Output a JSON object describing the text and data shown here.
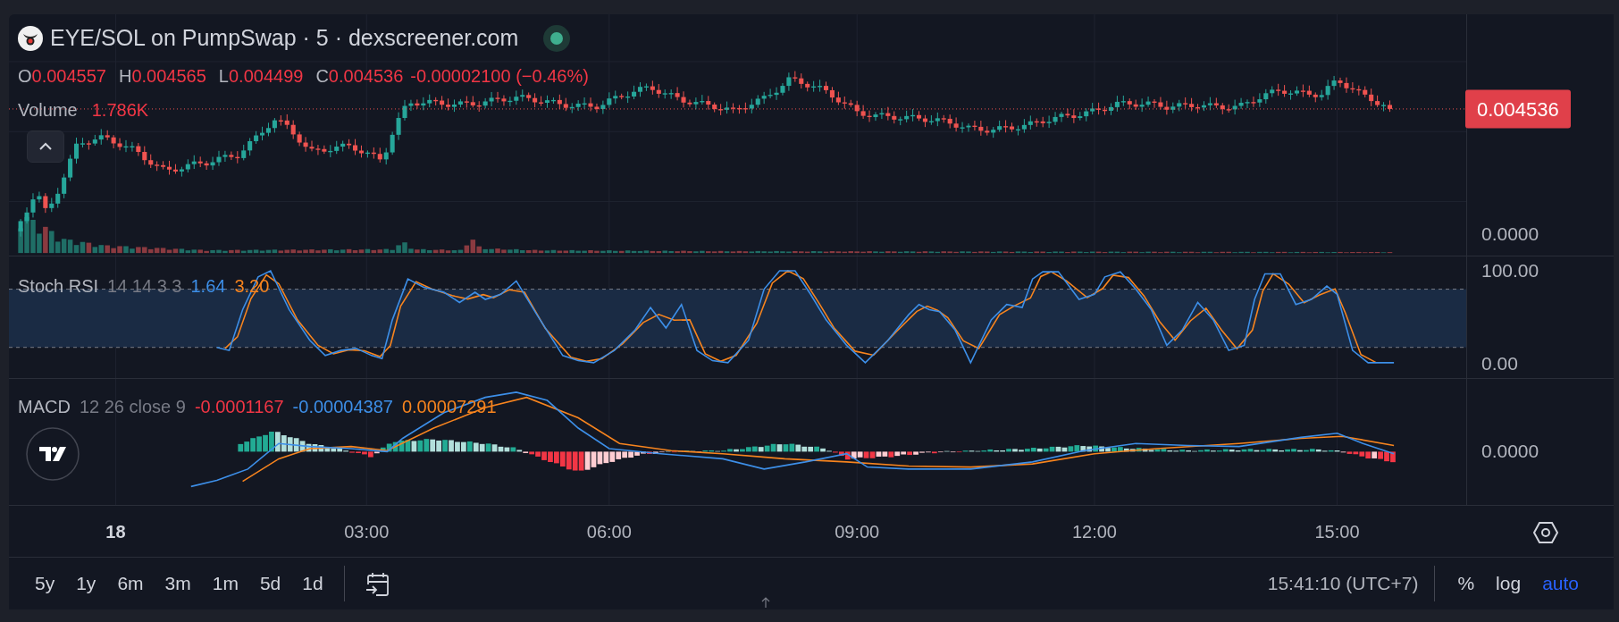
{
  "header": {
    "title": "EYE/SOL on PumpSwap · 5 · dexscreener.com"
  },
  "ohlc": [
    {
      "label": "O",
      "value": "0.004557"
    },
    {
      "label": "H",
      "value": "0.004565"
    },
    {
      "label": "L",
      "value": "0.004499"
    },
    {
      "label": "C",
      "value": "0.004536"
    }
  ],
  "change": "-0.00002100 (−0.46%)",
  "volume": {
    "label": "Volume",
    "value": "1.786K"
  },
  "price_axis": {
    "last_price": "0.004536",
    "ticks": [
      "0.0000"
    ]
  },
  "stoch_rsi": {
    "name": "Stoch RSI",
    "params": "14 14 3 3",
    "k": "1.64",
    "d": "3.20",
    "ticks": [
      "100.00",
      "0.00"
    ]
  },
  "macd": {
    "name": "MACD",
    "params": "12 26 close 9",
    "histogram": "-0.0001167",
    "macd": "-0.00004387",
    "signal": "0.00007291",
    "ticks": [
      "0.0000"
    ]
  },
  "time_axis": [
    {
      "label": "18",
      "kind": "day"
    },
    {
      "label": "03:00",
      "kind": "time"
    },
    {
      "label": "06:00",
      "kind": "time"
    },
    {
      "label": "09:00",
      "kind": "time"
    },
    {
      "label": "12:00",
      "kind": "time"
    },
    {
      "label": "15:00",
      "kind": "time"
    }
  ],
  "ranges": [
    "5y",
    "1y",
    "6m",
    "3m",
    "1m",
    "5d",
    "1d"
  ],
  "clock": "15:41:10 (UTC+7)",
  "scale_buttons": [
    {
      "label": "%",
      "selected": false
    },
    {
      "label": "log",
      "selected": false
    },
    {
      "label": "auto",
      "selected": true
    }
  ]
}
